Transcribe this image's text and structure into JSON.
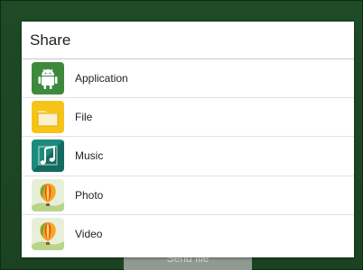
{
  "background": {
    "send_button_label": "Send file"
  },
  "dialog": {
    "title": "Share",
    "items": [
      {
        "label": "Application",
        "icon": "android-icon"
      },
      {
        "label": "File",
        "icon": "folder-icon"
      },
      {
        "label": "Music",
        "icon": "music-note-icon"
      },
      {
        "label": "Photo",
        "icon": "balloon-icon"
      },
      {
        "label": "Video",
        "icon": "balloon-icon"
      }
    ]
  },
  "colors": {
    "backdrop": "#1e4a26",
    "dialog_bg": "#ffffff",
    "android_icon": "#3d8a3c",
    "folder_icon": "#f6c319",
    "music_icon": "#1c8c7c"
  }
}
